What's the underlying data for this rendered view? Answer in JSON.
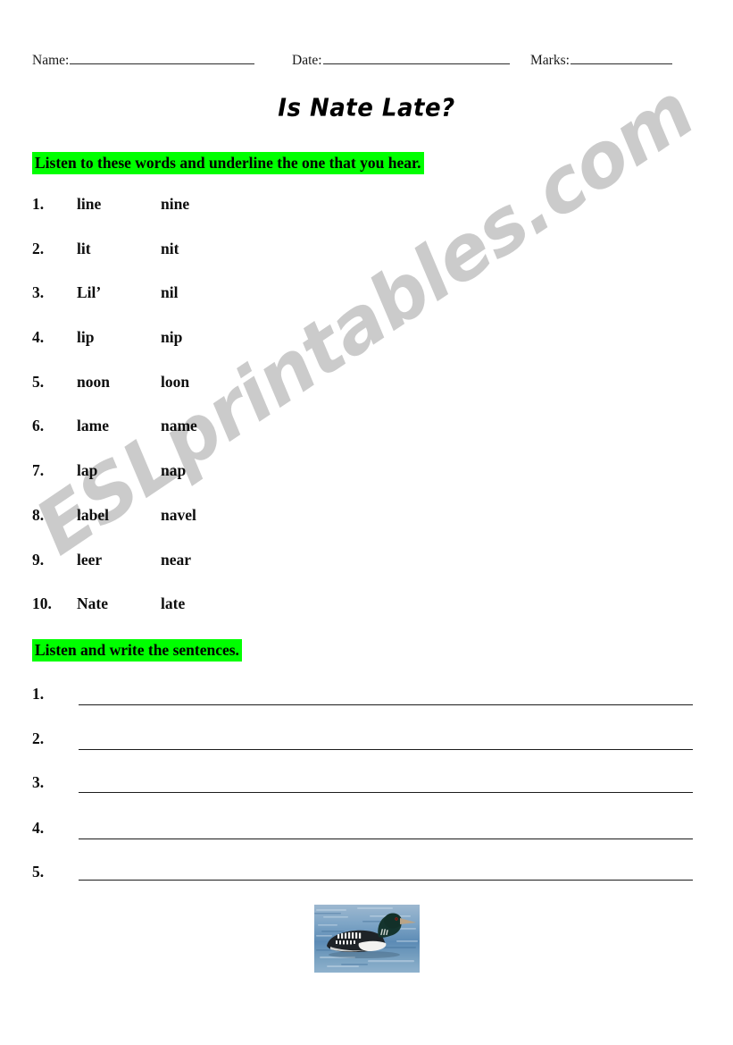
{
  "header": {
    "name_label": "Name:",
    "name_value": "",
    "date_label": "Date:",
    "date_value": "",
    "marks_label": "Marks:",
    "marks_value": ""
  },
  "title": "Is Nate Late?",
  "watermark": {
    "text": "ESLprintables.com",
    "color": "#c9c9c9"
  },
  "sections": [
    {
      "instruction": "Listen to these words and underline the one that you hear.",
      "highlight_color": "#00ff00"
    },
    {
      "instruction": "Listen and write the sentences.",
      "highlight_color": "#00ff00"
    }
  ],
  "word_list": {
    "rows": [
      {
        "number": "1.",
        "word_a": "line",
        "word_b": "nine"
      },
      {
        "number": "2.",
        "word_a": "lit",
        "word_b": "nit"
      },
      {
        "number": "3.",
        "word_a": "Lil’",
        "word_b": "nil"
      },
      {
        "number": "4.",
        "word_a": "lip",
        "word_b": "nip"
      },
      {
        "number": "5.",
        "word_a": "noon",
        "word_b": "loon"
      },
      {
        "number": "6.",
        "word_a": "lame",
        "word_b": "name"
      },
      {
        "number": "7.",
        "word_a": "lap",
        "word_b": "nap"
      },
      {
        "number": "8.",
        "word_a": "label",
        "word_b": "navel"
      },
      {
        "number": "9.",
        "word_a": "leer",
        "word_b": "near"
      },
      {
        "number": "10.",
        "word_a": "Nate",
        "word_b": "late"
      }
    ]
  },
  "writing_lines": {
    "rows": [
      {
        "number": "1.",
        "value": ""
      },
      {
        "number": "2.",
        "value": ""
      },
      {
        "number": "3.",
        "value": ""
      },
      {
        "number": "4.",
        "value": ""
      },
      {
        "number": "5.",
        "value": ""
      }
    ]
  },
  "photo": {
    "subject": "loon-swimming-on-water",
    "water_color": "#7ba2c4",
    "bird_body_color": "#1c1c1c",
    "bird_breast_color": "#f2f2f0"
  }
}
